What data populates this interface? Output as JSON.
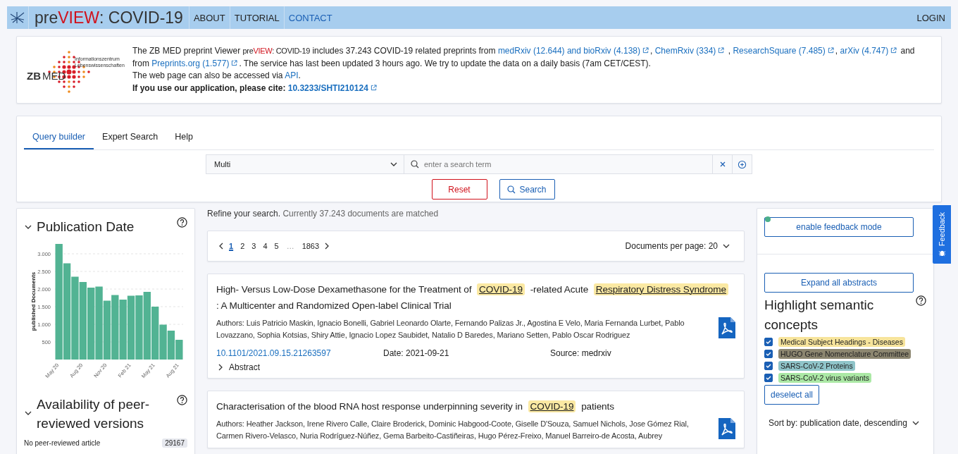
{
  "header": {
    "title": {
      "pre": "pre",
      "view": "VIEW",
      "rest": ": COVID-19"
    },
    "nav": [
      {
        "label": "ABOUT",
        "selected": false
      },
      {
        "label": "TUTORIAL",
        "selected": false
      },
      {
        "label": "CONTACT",
        "selected": true
      }
    ],
    "login": "LOGIN"
  },
  "info": {
    "logo": {
      "line1": "Informationszentrum",
      "line2": "Lebenswissenschaften",
      "zb": "ZB",
      "med": "MED"
    },
    "paragraphs": [
      {
        "bold": false,
        "segments": [
          {
            "kind": "text",
            "text": "The ZB MED preprint Viewer "
          },
          {
            "kind": "brand",
            "pre": "pre",
            "view": "VIEW",
            "rest": ": COVID-19"
          },
          {
            "kind": "text",
            "text": " includes 37.243 COVID-19 related preprints from "
          },
          {
            "kind": "link",
            "text": "medRxiv (12.644) and bioRxiv (4.138)",
            "external": true
          },
          {
            "kind": "text",
            "text": ", "
          },
          {
            "kind": "link",
            "text": "ChemRxiv (334)",
            "external": true
          },
          {
            "kind": "text",
            "text": " , "
          },
          {
            "kind": "link",
            "text": "ResearchSquare (7.485)",
            "external": true
          },
          {
            "kind": "text",
            "text": ", "
          },
          {
            "kind": "link",
            "text": "arXiv (4.747)",
            "external": true
          },
          {
            "kind": "text",
            "text": " and from "
          },
          {
            "kind": "link",
            "text": "Preprints.org (1.577)",
            "external": true
          },
          {
            "kind": "text",
            "text": ". The service has last been updated 3 hours ago. We try to update the data on a daily basis (7am CET/CEST)."
          }
        ]
      },
      {
        "bold": false,
        "segments": [
          {
            "kind": "text",
            "text": "The web page can also be accessed via "
          },
          {
            "kind": "link",
            "text": "API",
            "external": false
          },
          {
            "kind": "text",
            "text": "."
          }
        ]
      },
      {
        "bold": true,
        "segments": [
          {
            "kind": "text",
            "text": "If you use our application, please cite: "
          },
          {
            "kind": "link",
            "text": "10.3233/SHTI210124",
            "external": true
          }
        ]
      }
    ]
  },
  "search": {
    "tabs": [
      {
        "label": "Query builder",
        "selected": true
      },
      {
        "label": "Expert Search",
        "selected": false
      },
      {
        "label": "Help",
        "selected": false
      }
    ],
    "field_select": "Multi",
    "placeholder": "enter a search term",
    "reset": "Reset",
    "search": "Search"
  },
  "left": {
    "publication_date": {
      "title": "Publication Date",
      "expanded": true,
      "chart_data": {
        "type": "bar",
        "grid": true,
        "ylabel": "published Documents",
        "categories": [
          "May 20",
          null,
          null,
          "Aug 20",
          null,
          null,
          "Nov 20",
          null,
          null,
          "Feb 21",
          null,
          null,
          "May 21",
          null,
          null,
          "Aug 21"
        ],
        "values": [
          3280,
          2730,
          2350,
          2200,
          2040,
          2070,
          1670,
          1830,
          1700,
          1810,
          1820,
          1920,
          1500,
          990,
          820,
          560
        ],
        "ylim": [
          0,
          3300
        ],
        "yticks": [
          {
            "value": 500,
            "label": "500"
          },
          {
            "value": 1000,
            "label": "1.000"
          },
          {
            "value": 1500,
            "label": "1.500"
          },
          {
            "value": 2000,
            "label": "2.000"
          },
          {
            "value": 2500,
            "label": "2.500"
          },
          {
            "value": 3000,
            "label": "3.000"
          }
        ]
      }
    },
    "availability": {
      "title": "Availability of peer-reviewed versions",
      "expanded": true,
      "rows": [
        {
          "label": "No peer-reviewed article",
          "count": "29167"
        }
      ]
    }
  },
  "middle": {
    "refine": {
      "lead": "Refine your search.",
      "rest": " Currently 37.243 documents are matched"
    },
    "pagination": {
      "pages": [
        {
          "kind": "page",
          "label": "1",
          "selected": true
        },
        {
          "kind": "page",
          "label": "2",
          "selected": false
        },
        {
          "kind": "page",
          "label": "3",
          "selected": false
        },
        {
          "kind": "page",
          "label": "4",
          "selected": false
        },
        {
          "kind": "page",
          "label": "5",
          "selected": false
        },
        {
          "kind": "ellipsis",
          "label": "…"
        },
        {
          "kind": "page",
          "label": "1863",
          "selected": false
        }
      ],
      "per_page": "Documents per page: 20"
    },
    "articles": [
      {
        "title": [
          {
            "text": "High- Versus Low-Dose Dexamethasone for the Treatment of "
          },
          {
            "text": "COVID-19",
            "color": "#fbe9a3"
          },
          {
            "text": " -related Acute "
          },
          {
            "text": "Respiratory Distress Syndrome",
            "color": "#fbe9a3"
          },
          {
            "text": " : A Multicenter and Randomized Open-label Clinical Trial"
          }
        ],
        "authors": "Authors: Luis Patricio Maskin, Ignacio Bonelli, Gabriel Leonardo Olarte, Fernando Palizas Jr., Agostina E Velo, Maria Fernanda Lurbet, Pablo Lovazzano, Sophia Kotsias, Shiry Attie, Ignacio Lopez Saubidet, Natalio D Baredes, Mariano Setten, Pablo Oscar Rodriguez",
        "doi": "10.1101/2021.09.15.21263597",
        "date": "Date: 2021-09-21",
        "source": "Source: medrxiv",
        "abstract": "Abstract"
      },
      {
        "title": [
          {
            "text": "Characterisation of the blood RNA host response underpinning severity in "
          },
          {
            "text": "COVID-19",
            "color": "#fbe9a3"
          },
          {
            "text": " patients"
          }
        ],
        "authors": "Authors: Heather Jackson, Irene Rivero Calle, Claire Broderick, Dominic Habgood-Coote, Giselle D'Souza, Samuel Nichols, Jose Gómez Rial, Carmen Rivero-Velasco, Nuria Rodríguez-Núñez, Gema Barbeito-Castiñeiras, Hugo Pérez-Freixo, Manuel Barreiro-de Acosta, Aubrey"
      }
    ]
  },
  "right": {
    "feedback_status": {
      "color": "#4caf8a"
    },
    "feedback_button": "enable feedback mode",
    "expand_button": "Expand all abstracts",
    "title": "Highlight semantic concepts",
    "concepts": [
      {
        "label": "Medical Subject Headings - Diseases",
        "checked": true,
        "color": "#f7e49b"
      },
      {
        "label": "HUGO Gene Nomenclature Committee",
        "checked": true,
        "color": "#8c8670"
      },
      {
        "label": "SARS-CoV-2 Proteins",
        "checked": true,
        "color": "#8fc4c9"
      },
      {
        "label": "SARS-CoV-2 virus variants",
        "checked": true,
        "color": "#abe8a5"
      }
    ],
    "deselect": "deselect all",
    "sort": "Sort by: publication date, descending"
  },
  "feedback_tab": "Feedback"
}
